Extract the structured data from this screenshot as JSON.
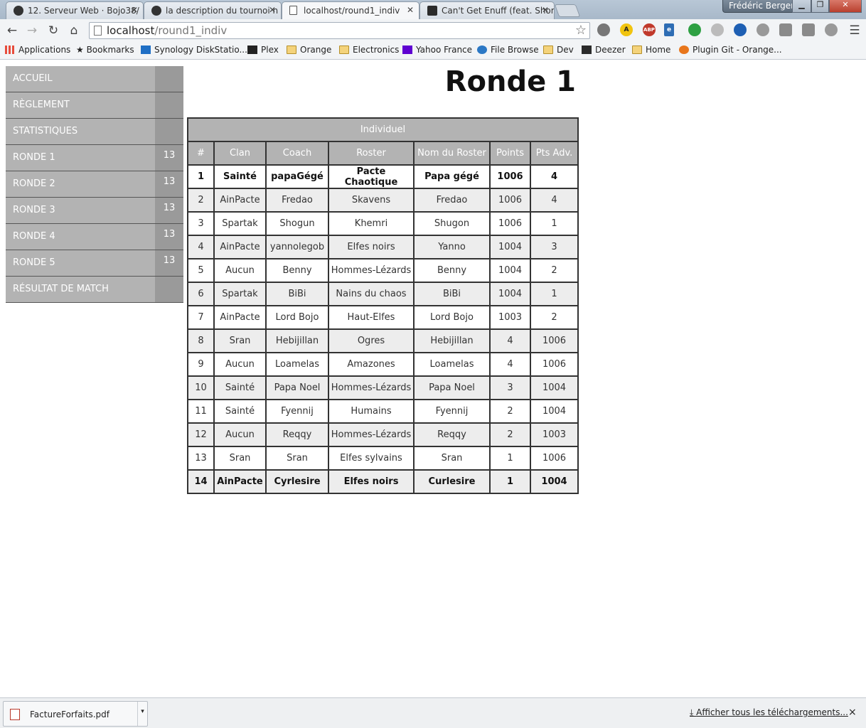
{
  "browser": {
    "tabs": [
      {
        "title": "12. Serveur Web · Bojo38/",
        "icon": "github-icon"
      },
      {
        "title": "la description du tournoi n",
        "icon": "github-icon"
      },
      {
        "title": "localhost/round1_indiv",
        "icon": "page-icon"
      },
      {
        "title": "Can't Get Enuff (feat. Shor",
        "icon": "deezer-icon"
      }
    ],
    "user": "Frédéric Berger",
    "url_host": "localhost",
    "url_path": "/round1_indiv",
    "bookmarks": [
      "Applications",
      "Bookmarks",
      "Synology DiskStatio...",
      "Plex",
      "Orange",
      "Electronics",
      "Yahoo France",
      "File Browse",
      "Dev",
      "Deezer",
      "Home",
      "Plugin Git - Orange..."
    ]
  },
  "sidebar": {
    "items": [
      {
        "label": "ACCUEIL",
        "count": ""
      },
      {
        "label": "RÈGLEMENT",
        "count": ""
      },
      {
        "label": "STATISTIQUES",
        "count": ""
      },
      {
        "label": "RONDE 1",
        "count": "13"
      },
      {
        "label": "RONDE 2",
        "count": "13"
      },
      {
        "label": "RONDE 3",
        "count": "13"
      },
      {
        "label": "RONDE 4",
        "count": "13"
      },
      {
        "label": "RONDE 5",
        "count": "13"
      },
      {
        "label": "RÉSULTAT DE MATCH",
        "count": ""
      }
    ]
  },
  "main": {
    "title": "Ronde 1",
    "table": {
      "caption": "Individuel",
      "headers": [
        "#",
        "Clan",
        "Coach",
        "Roster",
        "Nom du Roster",
        "Points",
        "Pts Adv."
      ],
      "rows": [
        [
          "1",
          "Sainté",
          "papaGégé",
          "Pacte Chaotique",
          "Papa gégé",
          "1006",
          "4"
        ],
        [
          "2",
          "AinPacte",
          "Fredao",
          "Skavens",
          "Fredao",
          "1006",
          "4"
        ],
        [
          "3",
          "Spartak",
          "Shogun",
          "Khemri",
          "Shugon",
          "1006",
          "1"
        ],
        [
          "4",
          "AinPacte",
          "yannolegob",
          "Elfes noirs",
          "Yanno",
          "1004",
          "3"
        ],
        [
          "5",
          "Aucun",
          "Benny",
          "Hommes-Lézards",
          "Benny",
          "1004",
          "2"
        ],
        [
          "6",
          "Spartak",
          "BiBi",
          "Nains du chaos",
          "BiBi",
          "1004",
          "1"
        ],
        [
          "7",
          "AinPacte",
          "Lord Bojo",
          "Haut-Elfes",
          "Lord Bojo",
          "1003",
          "2"
        ],
        [
          "8",
          "Sran",
          "Hebijillan",
          "Ogres",
          "Hebijillan",
          "4",
          "1006"
        ],
        [
          "9",
          "Aucun",
          "Loamelas",
          "Amazones",
          "Loamelas",
          "4",
          "1006"
        ],
        [
          "10",
          "Sainté",
          "Papa Noel",
          "Hommes-Lézards",
          "Papa Noel",
          "3",
          "1004"
        ],
        [
          "11",
          "Sainté",
          "Fyennij",
          "Humains",
          "Fyennij",
          "2",
          "1004"
        ],
        [
          "12",
          "Aucun",
          "Reqqy",
          "Hommes-Lézards",
          "Reqqy",
          "2",
          "1003"
        ],
        [
          "13",
          "Sran",
          "Sran",
          "Elfes sylvains",
          "Sran",
          "1",
          "1006"
        ],
        [
          "14",
          "AinPacte",
          "Cyrlesire",
          "Elfes noirs",
          "Curlesire",
          "1",
          "1004"
        ]
      ]
    }
  },
  "downloads": {
    "file": "FactureForfaits.pdf",
    "show_all": "Afficher tous les téléchargements...",
    "close": "×"
  }
}
